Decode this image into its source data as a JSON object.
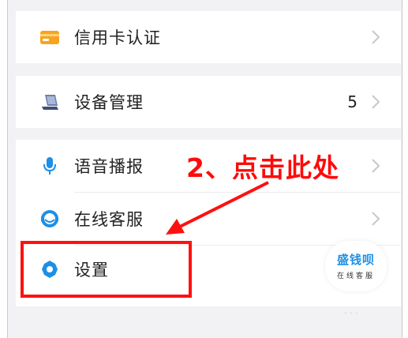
{
  "settings_menu": {
    "items": [
      {
        "label": "信用卡认证",
        "icon": "credit-card-icon",
        "count": ""
      },
      {
        "label": "设备管理",
        "icon": "device-icon",
        "count": "5"
      },
      {
        "label": "语音播报",
        "icon": "microphone-icon",
        "count": ""
      },
      {
        "label": "在线客服",
        "icon": "customer-service-icon",
        "count": ""
      },
      {
        "label": "设置",
        "icon": "settings-gear-icon",
        "count": ""
      }
    ]
  },
  "annotation": {
    "text": "2、点击此处",
    "color": "#ff0a0a"
  },
  "floating_service": {
    "title": "盛钱呗",
    "subtitle": "在线客服"
  },
  "colors": {
    "accent_blue": "#1d8fe6",
    "card_orange": "#f7a41d",
    "annotation_red": "#ff1010"
  }
}
